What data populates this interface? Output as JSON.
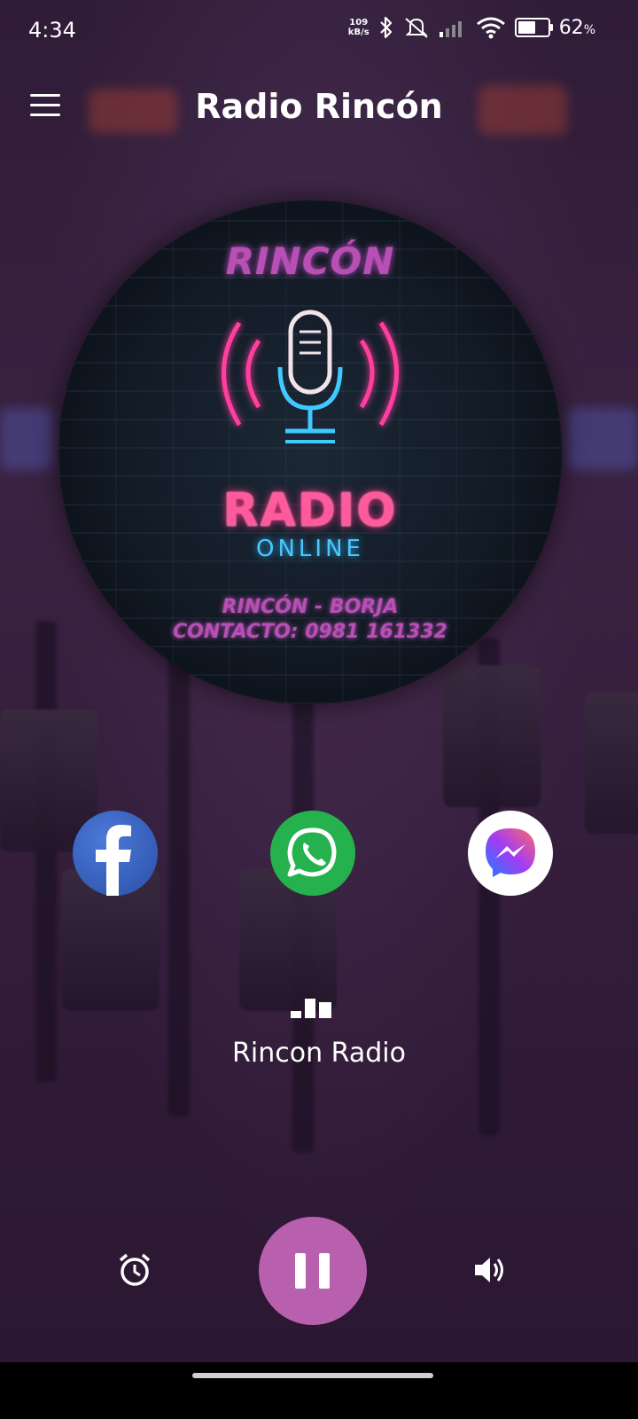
{
  "status_bar": {
    "time": "4:34",
    "net_speed_value": "109",
    "net_speed_unit": "kB/s",
    "battery_percent": "62",
    "battery_level": 0.62
  },
  "app_bar": {
    "title": "Radio Rincón",
    "menu_icon": "hamburger-menu-icon"
  },
  "logo": {
    "top_text": "RINCÓN",
    "radio_text": "RADIO",
    "online_text": "ONLINE",
    "location_text": "RINCÓN - BORJA",
    "contact_text": "CONTACTO: 0981 161332"
  },
  "social": [
    {
      "name": "facebook",
      "icon": "facebook-icon",
      "color": "#3b5998"
    },
    {
      "name": "whatsapp",
      "icon": "whatsapp-icon",
      "color": "#25b14e"
    },
    {
      "name": "messenger",
      "icon": "messenger-icon",
      "color": "#ffffff"
    }
  ],
  "now_playing": {
    "station": "Rincon Radio",
    "indicator_icon": "equalizer-icon"
  },
  "controls": {
    "alarm_icon": "alarm-clock-icon",
    "play_state_icon": "pause-icon",
    "volume_icon": "volume-icon",
    "accent_color": "#b85fae"
  }
}
